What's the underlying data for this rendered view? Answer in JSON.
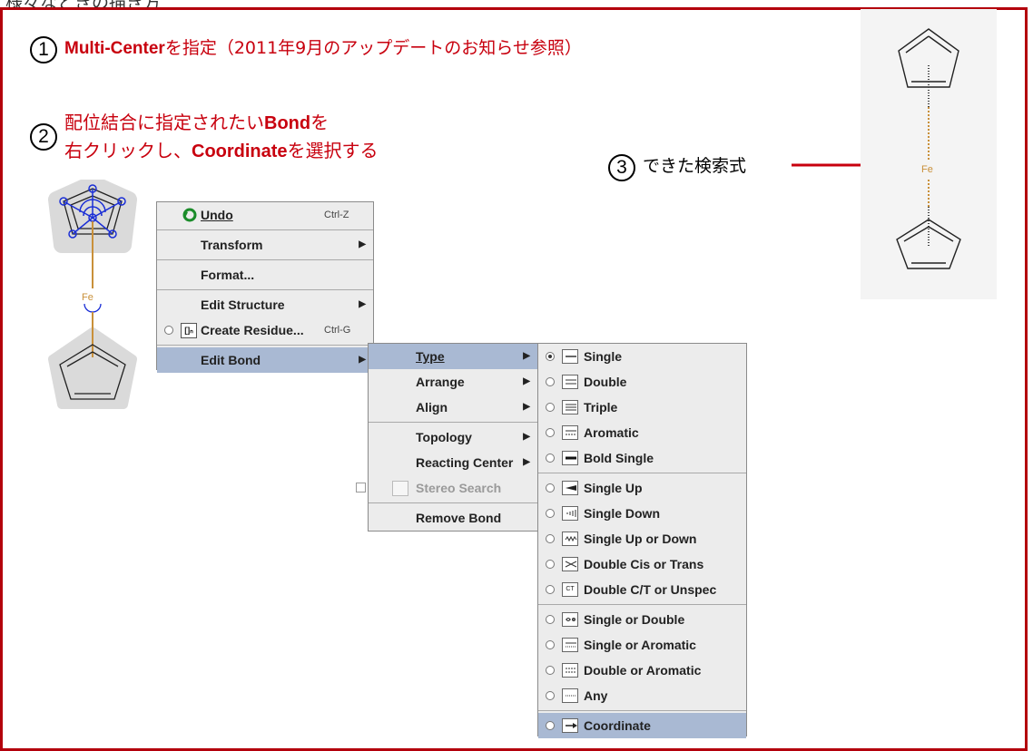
{
  "header": {
    "title": "様々なときの描き方"
  },
  "steps": [
    {
      "num": "1",
      "bold": "Multi-Center",
      "text": "を指定（2011年9月のアップデートのお知らせ参照）"
    },
    {
      "num": "2",
      "line1_a": "配位結合に指定されたい",
      "line1_b": "Bond",
      "line1_c": "を",
      "line2_a": "右クリックし、",
      "line2_b": "Coordinate",
      "line2_c": "を選択する"
    },
    {
      "num": "3",
      "text": "できた検索式"
    }
  ],
  "molecule": {
    "atom_label": "Fe"
  },
  "context_menu": [
    {
      "label": "Undo",
      "shortcut": "Ctrl-Z",
      "icon": "undo-icon"
    },
    {
      "label": "Transform",
      "arrow": "▶"
    },
    {
      "label": "Format..."
    },
    {
      "label": "Edit Structure",
      "arrow": "▶"
    },
    {
      "label": "Create Residue...",
      "shortcut": "Ctrl-G",
      "icon": "residue-icon",
      "icon_text": "[]ₙ"
    },
    {
      "label": "Edit Bond",
      "arrow": "▶"
    }
  ],
  "edit_bond_menu": [
    {
      "label": "Type",
      "arrow": "▶"
    },
    {
      "label": "Arrange",
      "arrow": "▶"
    },
    {
      "label": "Align",
      "arrow": "▶"
    },
    {
      "label": "Topology",
      "arrow": "▶"
    },
    {
      "label": "Reacting Center",
      "arrow": "▶"
    },
    {
      "label": "Stereo Search"
    },
    {
      "label": "Remove Bond"
    }
  ],
  "bond_type_menu": [
    {
      "label": "Single",
      "icon": "single-bond-icon",
      "checked": true
    },
    {
      "label": "Double",
      "icon": "double-bond-icon"
    },
    {
      "label": "Triple",
      "icon": "triple-bond-icon"
    },
    {
      "label": "Aromatic",
      "icon": "aromatic-bond-icon"
    },
    {
      "label": "Bold Single",
      "icon": "bold-single-bond-icon"
    },
    {
      "label": "Single Up",
      "icon": "wedge-up-icon"
    },
    {
      "label": "Single Down",
      "icon": "wedge-down-icon"
    },
    {
      "label": "Single Up or Down",
      "icon": "wavy-bond-icon"
    },
    {
      "label": "Double Cis or Trans",
      "icon": "cis-trans-icon"
    },
    {
      "label": "Double C/T or Unspec",
      "icon": "ct-unspec-icon",
      "icon_text": "CT"
    },
    {
      "label": "Single or Double",
      "icon": "single-or-double-icon"
    },
    {
      "label": "Single or Aromatic",
      "icon": "single-or-aromatic-icon"
    },
    {
      "label": "Double or Aromatic",
      "icon": "double-or-aromatic-icon"
    },
    {
      "label": "Any",
      "icon": "any-bond-icon"
    },
    {
      "label": "Coordinate",
      "icon": "coordinate-bond-icon"
    }
  ],
  "colors": {
    "accent_red": "#c8000e",
    "frame_red": "#b3000c",
    "menu_highlight": "#a9b9d3",
    "bond_orange": "#c9903a"
  }
}
